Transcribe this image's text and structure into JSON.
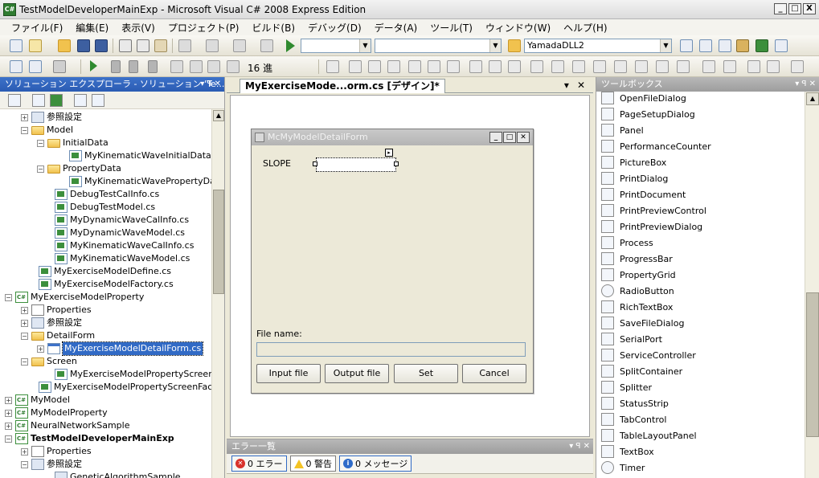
{
  "window": {
    "title": "TestModelDeveloperMainExp - Microsoft Visual C# 2008 Express Edition",
    "buttons": [
      "_",
      "□",
      "X"
    ]
  },
  "menu": [
    "ファイル(F)",
    "編集(E)",
    "表示(V)",
    "プロジェクト(P)",
    "ビルド(B)",
    "デバッグ(D)",
    "データ(A)",
    "ツール(T)",
    "ウィンドウ(W)",
    "ヘルプ(H)"
  ],
  "toolbar": {
    "project_combo": "YamadaDLL2",
    "radix": "16 進"
  },
  "solution_explorer": {
    "header": "ソリューション エクスプローラ - ソリューション 'Te...",
    "pin": "▾ ꟼ ✕",
    "tree": [
      {
        "label": "参照設定",
        "icon": "ref",
        "exp": "+"
      },
      {
        "label": "Model",
        "icon": "folder",
        "exp": "−"
      },
      {
        "label": "InitialData",
        "icon": "folder",
        "exp": "−"
      },
      {
        "label": "MyKinematicWaveInitialData.cs",
        "icon": "cs"
      },
      {
        "label": "PropertyData",
        "icon": "folder",
        "exp": "−"
      },
      {
        "label": "MyKinematicWavePropertyData",
        "icon": "cs"
      },
      {
        "label": "DebugTestCalInfo.cs",
        "icon": "cs"
      },
      {
        "label": "DebugTestModel.cs",
        "icon": "cs"
      },
      {
        "label": "MyDynamicWaveCalInfo.cs",
        "icon": "cs"
      },
      {
        "label": "MyDynamicWaveModel.cs",
        "icon": "cs"
      },
      {
        "label": "MyKinematicWaveCalInfo.cs",
        "icon": "cs"
      },
      {
        "label": "MyKinematicWaveModel.cs",
        "icon": "cs"
      },
      {
        "label": "MyExerciseModelDefine.cs",
        "icon": "cs"
      },
      {
        "label": "MyExerciseModelFactory.cs",
        "icon": "cs"
      },
      {
        "label": "MyExerciseModelProperty",
        "icon": "proj",
        "exp": "−"
      },
      {
        "label": "Properties",
        "icon": "props",
        "exp": "+"
      },
      {
        "label": "参照設定",
        "icon": "ref",
        "exp": "+"
      },
      {
        "label": "DetailForm",
        "icon": "folder",
        "exp": "−"
      },
      {
        "label": "MyExerciseModelDetailForm.cs",
        "icon": "form",
        "exp": "+"
      },
      {
        "label": "Screen",
        "icon": "folder",
        "exp": "−"
      },
      {
        "label": "MyExerciseModelPropertyScreen.c",
        "icon": "cs"
      },
      {
        "label": "MyExerciseModelPropertyScreenFacto",
        "icon": "cs"
      },
      {
        "label": "MyModel",
        "icon": "proj",
        "exp": "+"
      },
      {
        "label": "MyModelProperty",
        "icon": "proj",
        "exp": "+"
      },
      {
        "label": "NeuralNetworkSample",
        "icon": "proj",
        "exp": "+"
      },
      {
        "label": "TestModelDeveloperMainExp",
        "icon": "proj",
        "exp": "−"
      },
      {
        "label": "Properties",
        "icon": "props",
        "exp": "+"
      },
      {
        "label": "参照設定",
        "icon": "ref",
        "exp": "−"
      },
      {
        "label": "GeneticAlgorithmSample",
        "icon": "ref"
      }
    ]
  },
  "designer": {
    "tab_label": "MyExerciseMode...orm.cs [デザイン]*",
    "tab_controls": [
      "▾",
      "✕"
    ],
    "form": {
      "title": "McMyModelDetailForm",
      "slope_label": "SLOPE",
      "file_name_label": "File name:",
      "buttons": [
        "Input file",
        "Output file",
        "Set",
        "Cancel"
      ]
    }
  },
  "error_list": {
    "header": "エラー一覧",
    "errors": "0 エラー",
    "warnings": "0 警告",
    "messages": "0 メッセージ"
  },
  "toolbox": {
    "header": "ツールボックス",
    "items": [
      "OpenFileDialog",
      "PageSetupDialog",
      "Panel",
      "PerformanceCounter",
      "PictureBox",
      "PrintDialog",
      "PrintDocument",
      "PrintPreviewControl",
      "PrintPreviewDialog",
      "Process",
      "ProgressBar",
      "PropertyGrid",
      "RadioButton",
      "RichTextBox",
      "SaveFileDialog",
      "SerialPort",
      "ServiceController",
      "SplitContainer",
      "Splitter",
      "StatusStrip",
      "TabControl",
      "TableLayoutPanel",
      "TextBox",
      "Timer"
    ]
  }
}
